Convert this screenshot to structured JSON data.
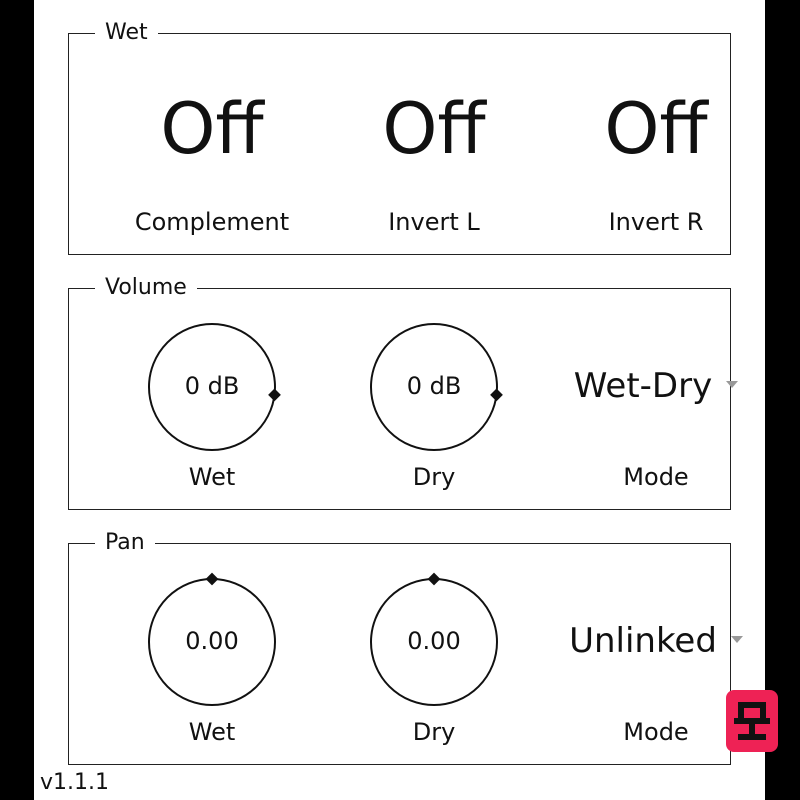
{
  "colors": {
    "background": "#ffffff",
    "frame": "#000000",
    "ink": "#111111",
    "logo": "#ee2255"
  },
  "wet": {
    "title": "Wet",
    "toggles": [
      {
        "state": "Off",
        "label": "Complement"
      },
      {
        "state": "Off",
        "label": "Invert L"
      },
      {
        "state": "Off",
        "label": "Invert R"
      }
    ]
  },
  "volume": {
    "title": "Volume",
    "knobs": [
      {
        "value": "0 dB",
        "label": "Wet",
        "level": 0.86
      },
      {
        "value": "0 dB",
        "label": "Dry",
        "level": 0.86
      }
    ],
    "mode": {
      "value": "Wet-Dry",
      "label": "Mode",
      "icon": "chevron-down-icon"
    }
  },
  "pan": {
    "title": "Pan",
    "knobs": [
      {
        "value": "0.00",
        "label": "Wet",
        "level": 0.5
      },
      {
        "value": "0.00",
        "label": "Dry",
        "level": 0.5
      }
    ],
    "mode": {
      "value": "Unlinked",
      "label": "Mode",
      "icon": "chevron-down-icon"
    }
  },
  "version": "v1.1.1"
}
